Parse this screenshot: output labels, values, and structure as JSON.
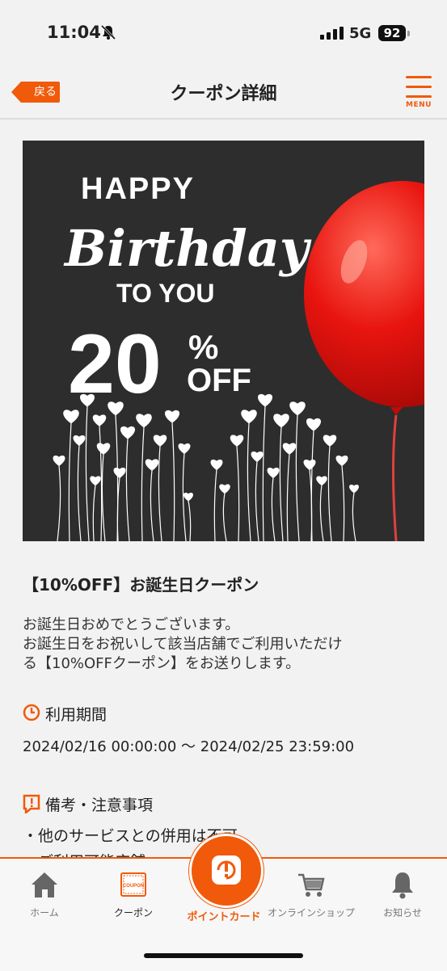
{
  "status": {
    "time": "11:04",
    "network": "5G",
    "battery": "92"
  },
  "header": {
    "back_label": "戻る",
    "title": "クーポン詳細",
    "menu_label": "MENU"
  },
  "banner": {
    "line1": "HAPPY",
    "line2": "Birthday",
    "line3": "TO YOU",
    "percent_number": "20",
    "percent_sign": "%",
    "off": "OFF"
  },
  "coupon": {
    "title": "【10%OFF】お誕生日クーポン",
    "description": [
      "お誕生日おめでとうございます。",
      "お誕生日をお祝いして該当店舗でご利用いただけ",
      "る【10%OFFクーポン】をお送りします。"
    ],
    "period_label": "利用期間",
    "period_value": "2024/02/16 00:00:00 〜 2024/02/25 23:59:00",
    "notes_label": "備考・注意事項",
    "notes": [
      "・他のサービスとの併用は不可",
      "・ご利用可能店舗"
    ]
  },
  "tabbar": {
    "home": "ホーム",
    "coupon": "クーポン",
    "coupon_icon_text": "COUPON",
    "point_card": "ポイントカード",
    "online_shop": "オンラインショップ",
    "notice": "お知らせ"
  },
  "colors": {
    "accent": "#f05a0a",
    "banner_bg": "#2d2d2d",
    "balloon": "#e8140f"
  }
}
